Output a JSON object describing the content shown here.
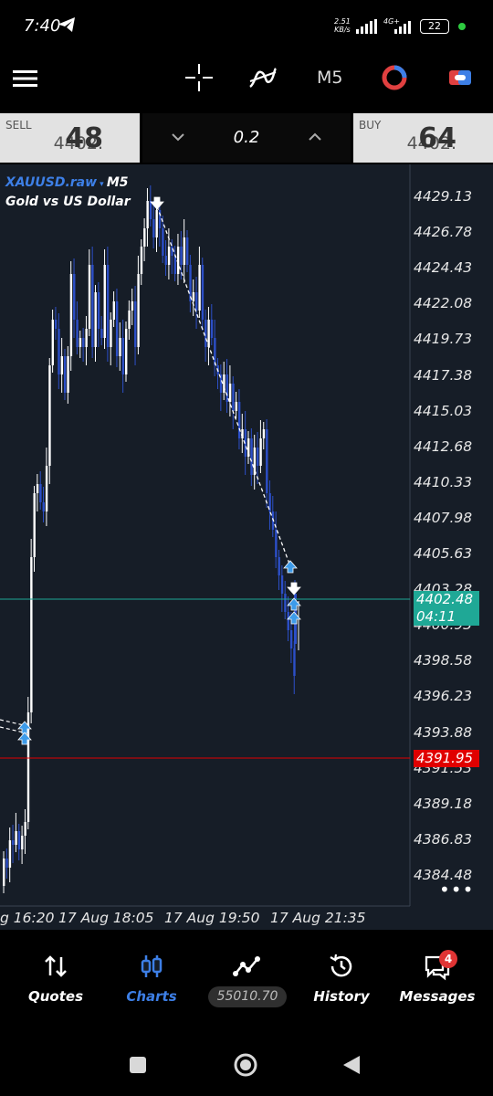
{
  "status": {
    "time": "7:40",
    "speed_value": "2.51",
    "speed_unit": "KB/s",
    "network": "4G+",
    "battery": "22"
  },
  "toolbar": {
    "timeframe": "M5",
    "icons": [
      "menu-icon",
      "crosshair-icon",
      "indicators-icon",
      "timeframe-label",
      "chart-type-icon",
      "trade-icon"
    ]
  },
  "prices": {
    "sell_label": "SELL",
    "sell_small": "4402.",
    "sell_big": "48",
    "buy_label": "BUY",
    "buy_small": "4402.",
    "buy_big": "64",
    "volume": "0.2"
  },
  "chart": {
    "symbol": "XAUUSD.raw",
    "symbol_tf": "M5",
    "symbol_name": "Gold vs US Dollar",
    "price_scale": [
      "4429.13",
      "4426.78",
      "4424.43",
      "4422.08",
      "4419.73",
      "4417.38",
      "4415.03",
      "4412.68",
      "4410.33",
      "4407.98",
      "4405.63",
      "4403.28",
      "4400.93",
      "4398.58",
      "4396.23",
      "4393.88",
      "4391.53",
      "4389.18",
      "4386.83",
      "4384.48"
    ],
    "time_scale": [
      "g 16:20",
      "17 Aug 18:05",
      "17 Aug 19:50",
      "17 Aug 21:35"
    ],
    "current_price": "4402.48",
    "countdown": "04:11",
    "level_price": "4391.95",
    "colors": {
      "background": "#161d27",
      "bull": "#ffffff",
      "bear": "#2c4fc8",
      "current_line": "#1fa896",
      "level_line": "#e00000"
    }
  },
  "nav": {
    "items": [
      {
        "label": "Quotes",
        "icon": "quotes-icon"
      },
      {
        "label": "Charts",
        "icon": "charts-icon"
      },
      {
        "label": "",
        "icon": "trade-icon"
      },
      {
        "label": "History",
        "icon": "history-icon"
      },
      {
        "label": "Messages",
        "icon": "messages-icon"
      }
    ],
    "balance": "55010.70",
    "messages_badge": "4"
  }
}
